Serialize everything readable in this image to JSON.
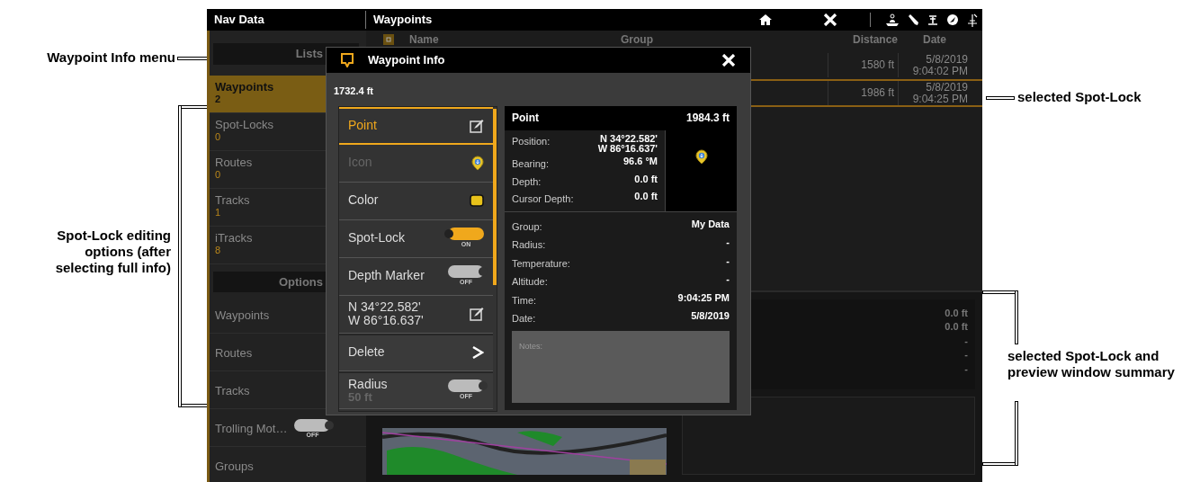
{
  "callouts": [
    {
      "text": "Waypoint Info menu"
    },
    {
      "text": "Spot-Lock editing options (after selecting full info)"
    },
    {
      "text": "selected Spot-Lock"
    },
    {
      "text": "selected Spot-Lock and preview window summary"
    }
  ],
  "top_bar": {
    "left_title": "Nav Data",
    "right_title": "Waypoints"
  },
  "sidebar": {
    "sections": [
      {
        "heading": "Lists",
        "items": [
          {
            "kind": "list",
            "label": "Waypoints",
            "count": "2",
            "selected": true
          },
          {
            "kind": "list",
            "label": "Spot-Locks",
            "count": "0",
            "selected": false
          },
          {
            "kind": "list",
            "label": "Routes",
            "count": "0",
            "selected": false
          },
          {
            "kind": "list",
            "label": "Tracks",
            "count": "1",
            "selected": false
          },
          {
            "kind": "list",
            "label": "iTracks",
            "count": "8",
            "selected": false
          }
        ]
      },
      {
        "heading": "Options",
        "items": [
          {
            "kind": "link",
            "label": "Waypoints"
          },
          {
            "kind": "link",
            "label": "Routes"
          },
          {
            "kind": "link",
            "label": "Tracks"
          },
          {
            "kind": "toggle",
            "label": "Trolling Mot…",
            "on": false,
            "state_label": "OFF"
          },
          {
            "kind": "link",
            "label": "Groups"
          }
        ]
      }
    ]
  },
  "table": {
    "columns": [
      "Name",
      "Group",
      "Distance",
      "Date"
    ],
    "rows": [
      {
        "distance": "1580 ft",
        "date": "5/8/2019",
        "time": "9:04:02 PM",
        "selected": false
      },
      {
        "distance": "1986 ft",
        "date": "5/8/2019",
        "time": "9:04:25 PM",
        "selected": true
      }
    ]
  },
  "preview": {
    "values": [
      "0.0 ft",
      "0.0 ft",
      "-",
      "-",
      "-"
    ]
  },
  "dialog": {
    "title": "Waypoint Info",
    "distance": "1732.4 ft",
    "options": [
      {
        "kind": "edit",
        "label": "Point",
        "selected": true,
        "disabled": false
      },
      {
        "kind": "pin",
        "label": "Icon",
        "selected": false,
        "disabled": true
      },
      {
        "kind": "swatch",
        "label": "Color",
        "selected": false,
        "disabled": false
      },
      {
        "kind": "toggle",
        "label": "Spot-Lock",
        "on": true,
        "state_label": "ON",
        "selected": false,
        "disabled": false
      },
      {
        "kind": "toggle",
        "label": "Depth Marker",
        "on": false,
        "state_label": "OFF",
        "selected": false,
        "disabled": false
      },
      {
        "kind": "edit",
        "label": "N 34°22.582'\nW 86°16.637'",
        "selected": false,
        "disabled": false
      },
      {
        "kind": "action",
        "label": "Delete",
        "selected": false,
        "disabled": false
      },
      {
        "kind": "toggle",
        "label": "Radius",
        "sublabel": "50 ft",
        "on": false,
        "state_label": "OFF",
        "selected": false,
        "disabled": false
      }
    ],
    "details": {
      "title": "Point",
      "distance": "1984.3 ft",
      "top_rows": [
        {
          "label": "Position:",
          "value": "N 34°22.582'\nW 86°16.637'"
        },
        {
          "label": "Bearing:",
          "value": "96.6 °M"
        },
        {
          "label": "Depth:",
          "value": "0.0 ft"
        },
        {
          "label": "Cursor Depth:",
          "value": "0.0 ft"
        }
      ],
      "rows": [
        {
          "label": "Group:",
          "value": "My Data"
        },
        {
          "label": "Radius:",
          "value": "-"
        },
        {
          "label": "Temperature:",
          "value": "-"
        },
        {
          "label": "Altitude:",
          "value": "-"
        },
        {
          "label": "Time:",
          "value": "9:04:25 PM"
        },
        {
          "label": "Date:",
          "value": "5/8/2019"
        }
      ],
      "notes_label": "Notes:"
    }
  }
}
